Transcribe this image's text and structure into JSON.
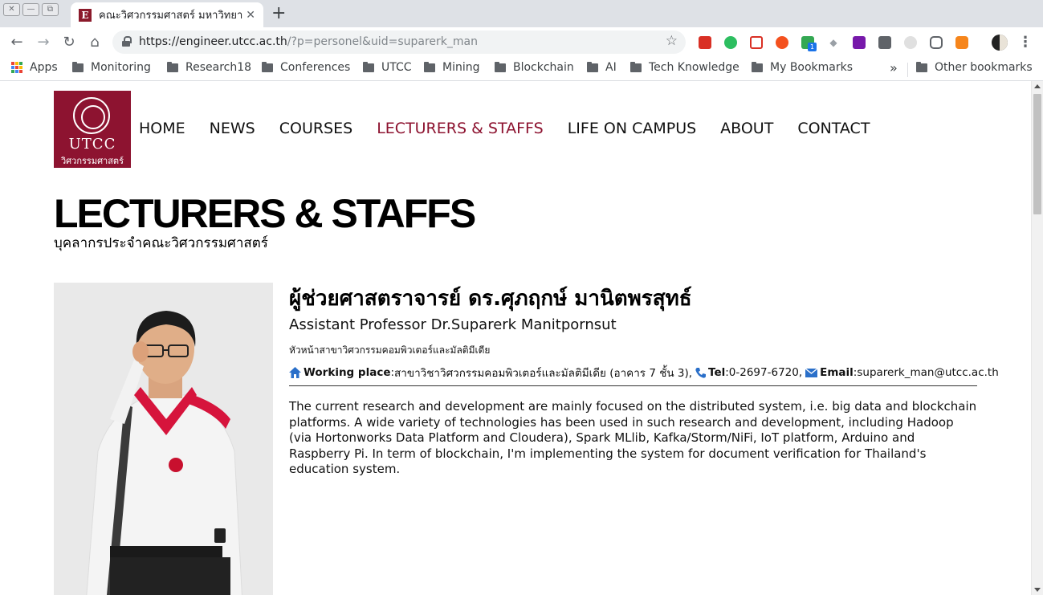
{
  "browser": {
    "window_controls": [
      "✕",
      "—",
      "⧉"
    ],
    "tab": {
      "favicon_letter": "E",
      "title": "คณะวิศวกรรมศาสตร์ มหาวิทยาลัยหอการค้าไทย"
    },
    "new_tab": "+",
    "url": {
      "base": "https://engineer.utcc.ac.th",
      "path": "/?p=personel&uid=suparerk_man"
    },
    "bookmarks": [
      {
        "label": "Apps",
        "icon": "apps-grid-icon"
      },
      {
        "label": "Monitoring",
        "icon": "folder-icon"
      },
      {
        "label": "Research18",
        "icon": "folder-icon"
      },
      {
        "label": "Conferences",
        "icon": "folder-icon"
      },
      {
        "label": "UTCC",
        "icon": "folder-icon"
      },
      {
        "label": "Mining",
        "icon": "folder-icon"
      },
      {
        "label": "Blockchain",
        "icon": "folder-icon"
      },
      {
        "label": "AI",
        "icon": "folder-icon"
      },
      {
        "label": "Tech Knowledge",
        "icon": "folder-icon"
      },
      {
        "label": "My Bookmarks",
        "icon": "folder-icon"
      }
    ],
    "overflow_chevron": "»",
    "other_bookmarks": "Other bookmarks",
    "extension_badge": "1"
  },
  "site": {
    "logo": {
      "text": "UTCC",
      "thai": "วิศวกรรมศาสตร์",
      "color": "#8d1330"
    },
    "nav": [
      {
        "label": "HOME",
        "active": false
      },
      {
        "label": "NEWS",
        "active": false
      },
      {
        "label": "COURSES",
        "active": false
      },
      {
        "label": "LECTURERS & STAFFS",
        "active": true
      },
      {
        "label": "LIFE ON CAMPUS",
        "active": false
      },
      {
        "label": "ABOUT",
        "active": false
      },
      {
        "label": "CONTACT",
        "active": false
      }
    ],
    "accent_color": "#8d1330"
  },
  "main": {
    "title": "LECTURERS & STAFFS",
    "subtitle": "บุคลากรประจำคณะวิศวกรรมศาสตร์",
    "person": {
      "name_th": "ผู้ช่วยศาสตราจารย์ ดร.ศุภฤกษ์ มานิตพรสุทธ์",
      "name_en": "Assistant Professor Dr.Suparerk Manitpornsut",
      "position": "หัวหน้าสาขาวิศวกรรมคอมพิวเตอร์และมัลติมีเดีย",
      "working_place_label": "Working place",
      "working_place": "สาขาวิชาวิศวกรรมคอมพิวเตอร์และมัลติมีเดีย (อาคาร 7 ชั้น 3),",
      "tel_label": "Tel",
      "tel": "0-2697-6720,",
      "email_label": "Email",
      "email": "suparerk_man@utcc.ac.th",
      "bio": "The current research and development are mainly focused on the distributed system, i.e. big data and blockchain platforms. A wide variety of technologies has been used in such research and development, including Hadoop (via Hortonworks Data Platform and Cloudera), Spark MLlib, Kafka/Storm/NiFi, IoT platform, Arduino and Raspberry Pi. In term of blockchain, I'm implementing the system for document verification for Thailand's education system."
    }
  }
}
